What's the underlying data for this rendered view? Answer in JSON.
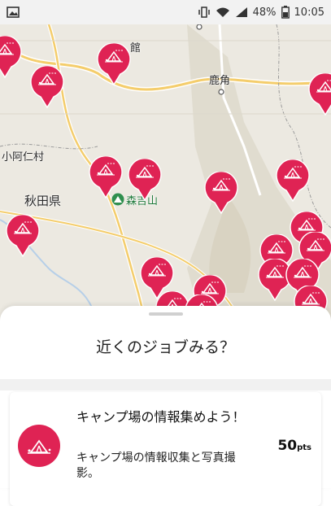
{
  "status_bar": {
    "battery": "48%",
    "time": "10:05"
  },
  "map": {
    "labels": [
      "館",
      "鹿角",
      "小阿仁村",
      "秋田県",
      "森吉山"
    ],
    "marker_icon": "camping-tent-icon",
    "marker_color": "#df2354"
  },
  "sheet": {
    "title": "近くのジョブみる？",
    "job": {
      "title": "キャンプ場の情報集めよう！",
      "description": "キャンプ場の情報収集と写真撮影。",
      "points": "50",
      "points_unit": "pts",
      "icon": "camping-tent-icon"
    }
  }
}
